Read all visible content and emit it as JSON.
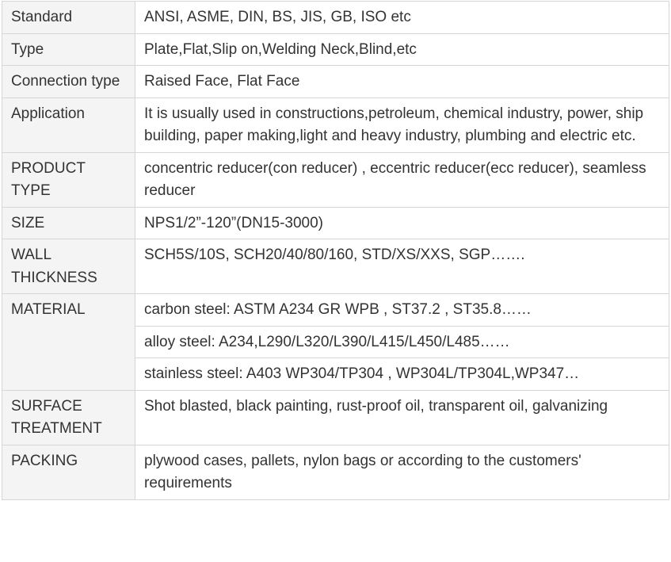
{
  "spec_table": {
    "rows": [
      {
        "label": "Standard",
        "value": "ANSI, ASME, DIN, BS, JIS, GB, ISO etc"
      },
      {
        "label": "Type",
        "value": "Plate,Flat,Slip on,Welding Neck,Blind,etc"
      },
      {
        "label": "Connection type",
        "value": "Raised Face, Flat Face"
      },
      {
        "label": "Application",
        "value": "It is usually used in constructions,petroleum, chemical industry, power, ship building, paper making,light and heavy industry, plumbing and electric etc."
      },
      {
        "label": "PRODUCT TYPE",
        "value": "concentric reducer(con reducer) , eccentric reducer(ecc reducer), seamless reducer"
      },
      {
        "label": "SIZE",
        "value": "NPS1/2”-120”(DN15-3000)"
      },
      {
        "label": "WALL THICKNESS",
        "value": "SCH5S/10S, SCH20/40/80/160, STD/XS/XXS, SGP……."
      },
      {
        "label": "MATERIAL",
        "values": [
          "carbon steel: ASTM A234 GR WPB , ST37.2 , ST35.8……",
          "alloy steel: A234,L290/L320/L390/L415/L450/L485……",
          "stainless steel: A403 WP304/TP304 , WP304L/TP304L,WP347…"
        ]
      },
      {
        "label": "SURFACE TREATMENT",
        "value": "Shot blasted, black painting, rust-proof oil, transparent oil, galvanizing"
      },
      {
        "label": "PACKING",
        "value": "plywood cases, pallets, nylon bags or according to the customers' requirements"
      }
    ]
  }
}
